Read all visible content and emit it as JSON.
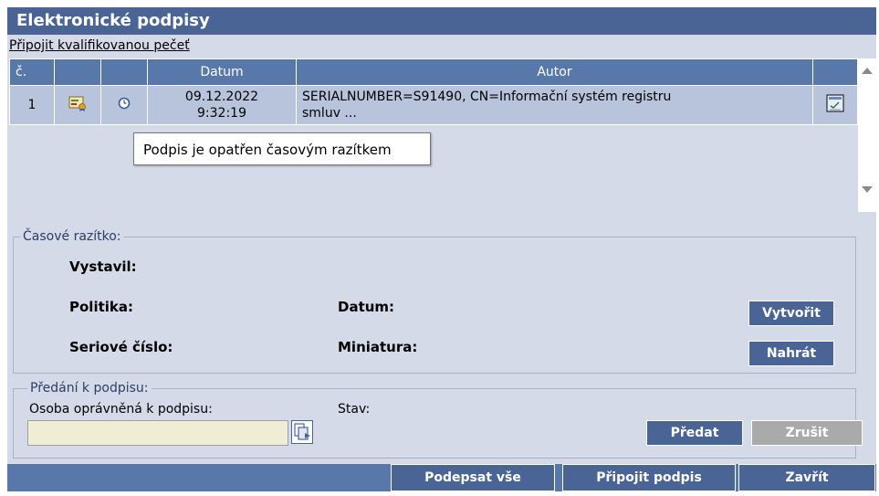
{
  "title": "Elektronické podpisy",
  "attach_seal_link": "Připojit kvalifikovanou pečeť",
  "table": {
    "headers": [
      "č.",
      "",
      "",
      "Datum",
      "Autor",
      ""
    ],
    "rows": [
      {
        "num": "1",
        "date_line1": "09.12.2022",
        "date_line2": "9:32:19",
        "author_line1": "SERIALNUMBER=S91490, CN=Informační systém registru",
        "author_line2": "smluv ..."
      }
    ]
  },
  "tooltip": "Podpis je opatřen časovým razítkem",
  "timestamp": {
    "legend": "Časové razítko:",
    "vystavil": "Vystavil:",
    "politika": "Politika:",
    "datum": "Datum:",
    "seriove": "Seriové číslo:",
    "miniatura": "Miniatura:",
    "create_button": "Vytvořit",
    "upload_button": "Nahrát"
  },
  "handover": {
    "legend": "Předání k podpisu:",
    "osoba_label": "Osoba oprávněná k podpisu:",
    "osoba_value": "",
    "stav_label": "Stav:",
    "predat_button": "Předat",
    "zrusit_button": "Zrušit"
  },
  "footer": {
    "sign_all": "Podepsat vše",
    "attach_signature": "Připojit podpis",
    "close": "Zavřít"
  },
  "colors": {
    "accent": "#4a6496",
    "header": "#5878aa",
    "row": "#b8c4dc",
    "panel": "#d4dae8"
  }
}
